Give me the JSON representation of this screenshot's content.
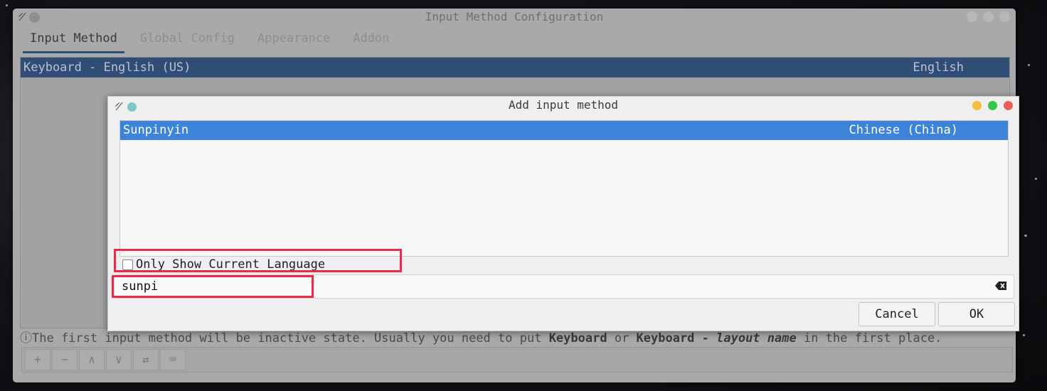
{
  "main_window": {
    "title": "Input Method Configuration",
    "tabs": [
      {
        "label": "Input Method"
      },
      {
        "label": "Global Config"
      },
      {
        "label": "Appearance"
      },
      {
        "label": "Addon"
      }
    ],
    "list_row": {
      "name": "Keyboard - English (US)",
      "language": "English"
    },
    "hint": {
      "icon": "ⓘ",
      "part1": "The first input method will be inactive state. Usually you need to put ",
      "bold1": "Keyboard",
      "part2": " or ",
      "bold2": "Keyboard - ",
      "bold_italic": "layout name",
      "part3": " in the first place."
    },
    "toolbar": {
      "add": "+",
      "remove": "−",
      "up": "∧",
      "down": "∨",
      "configure": "⇄",
      "keyboard": "⌨"
    }
  },
  "dialog": {
    "title": "Add input method",
    "list_row": {
      "name": "Sunpinyin",
      "language": "Chinese (China)"
    },
    "checkbox_label": "Only Show Current Language",
    "search_value": "sunpi",
    "cancel_label": "Cancel",
    "ok_label": "OK"
  },
  "colors": {
    "selection": "#3d84d8",
    "highlight_box": "#ee2a4b",
    "close": "#ec5f5a",
    "minimize": "#f5bd3c",
    "maximize": "#32c748"
  }
}
